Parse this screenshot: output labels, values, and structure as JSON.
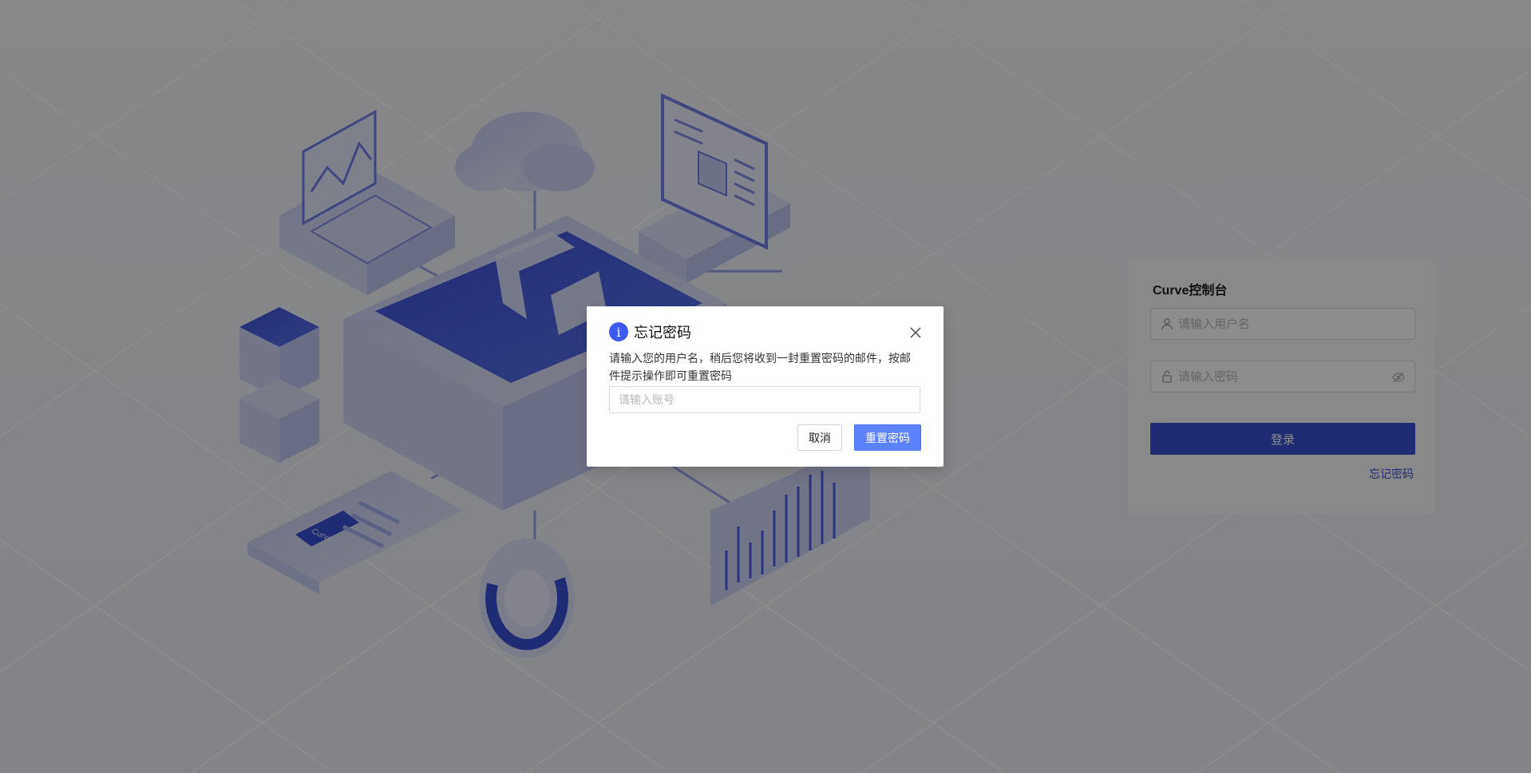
{
  "login": {
    "title": "Curve控制台",
    "username_placeholder": "请输入用户名",
    "password_placeholder": "请输入密码",
    "login_label": "登录",
    "forgot_label": "忘记密码",
    "user_icon": "user-icon",
    "lock_icon": "lock-icon",
    "eye_icon": "eye-invisible-icon"
  },
  "illustration": {
    "card_label": "Curve"
  },
  "modal": {
    "title": "忘记密码",
    "info_icon": "info-icon",
    "info_glyph": "i",
    "description": "请输入您的用户名，稍后您将收到一封重置密码的邮件，按邮件提示操作即可重置密码",
    "account_placeholder": "请输入账号",
    "cancel_label": "取消",
    "reset_label": "重置密码"
  },
  "colors": {
    "primary": "#3a4fd0",
    "modal_primary": "#5b82ff",
    "info": "#3d5bf0"
  }
}
